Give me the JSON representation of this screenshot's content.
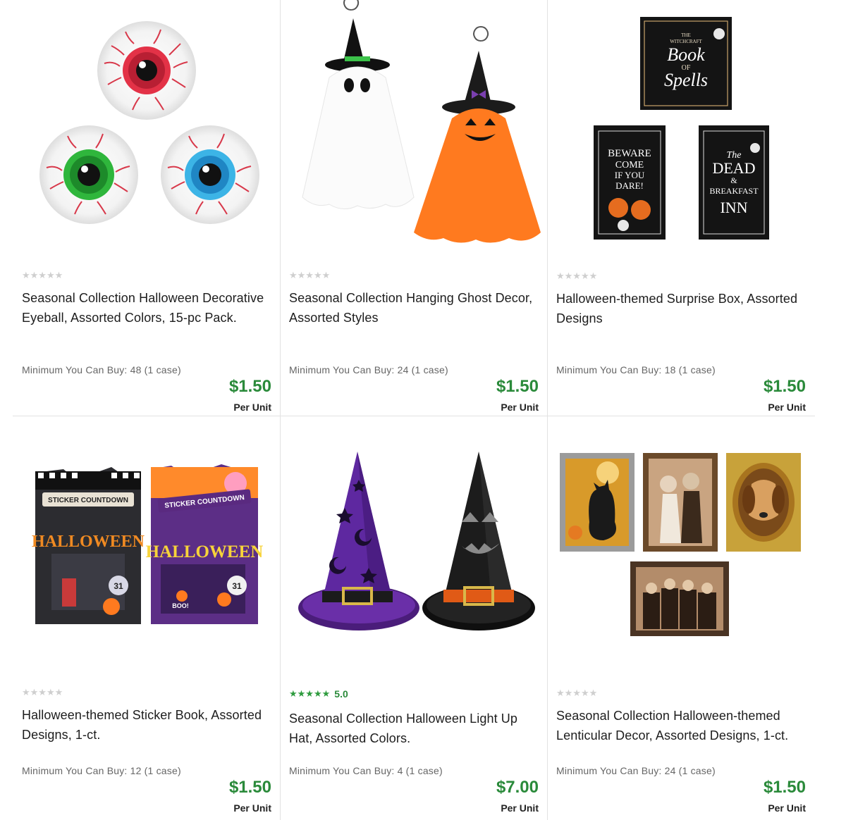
{
  "products": [
    {
      "title": "Seasonal Collection Halloween Decorative Eyeball, Assorted Colors, 15-pc Pack.",
      "rating_stars": "★★★★★",
      "rating_value": "",
      "min_buy": "Minimum You Can Buy: 48 (1 case)",
      "price": "$1.50",
      "per_unit": "Per Unit",
      "image_icon": "eyeball-image"
    },
    {
      "title": "Seasonal Collection Hanging Ghost Decor, Assorted Styles",
      "rating_stars": "★★★★★",
      "rating_value": "",
      "min_buy": "Minimum You Can Buy: 24 (1 case)",
      "price": "$1.50",
      "per_unit": "Per Unit",
      "image_icon": "ghost-image"
    },
    {
      "title": "Halloween-themed Surprise Box, Assorted Designs",
      "rating_stars": "★★★★★",
      "rating_value": "",
      "min_buy": "Minimum You Can Buy: 18 (1 case)",
      "price": "$1.50",
      "per_unit": "Per Unit",
      "image_icon": "surprise-box-image",
      "image_text": {
        "box1": [
          "THE",
          "WITCHCRAFT",
          "Book",
          "OF",
          "Spells"
        ],
        "box2": [
          "BEWARE",
          "COME",
          "IF YOU",
          "DARE!"
        ],
        "box3": [
          "The",
          "DEAD",
          "&",
          "BREAKFAST",
          "INN"
        ]
      }
    },
    {
      "title": "Halloween-themed Sticker Book, Assorted Designs, 1-ct.",
      "rating_stars": "★★★★★",
      "rating_value": "",
      "min_buy": "Minimum You Can Buy: 12 (1 case)",
      "price": "$1.50",
      "per_unit": "Per Unit",
      "image_icon": "sticker-book-image",
      "image_text": {
        "banner": "STICKER COUNTDOWN",
        "word": "HALLOWEEN",
        "badge": "31",
        "boo": "BOO!"
      }
    },
    {
      "title": "Seasonal Collection Halloween Light Up Hat, Assorted Colors.",
      "rating_stars": "★★★★★",
      "rating_value": "5.0",
      "min_buy": "Minimum You Can Buy: 4 (1 case)",
      "price": "$7.00",
      "per_unit": "Per Unit",
      "image_icon": "witch-hat-image"
    },
    {
      "title": "Seasonal Collection Halloween-themed Lenticular Decor, Assorted Designs, 1-ct.",
      "rating_stars": "★★★★★",
      "rating_value": "",
      "min_buy": "Minimum You Can Buy: 24 (1 case)",
      "price": "$1.50",
      "per_unit": "Per Unit",
      "image_icon": "lenticular-frames-image"
    }
  ],
  "colors": {
    "price_green": "#2a8a3a",
    "star_empty": "#cfcfcf",
    "star_filled": "#2e9b3e",
    "divider": "#e2e2e2"
  }
}
